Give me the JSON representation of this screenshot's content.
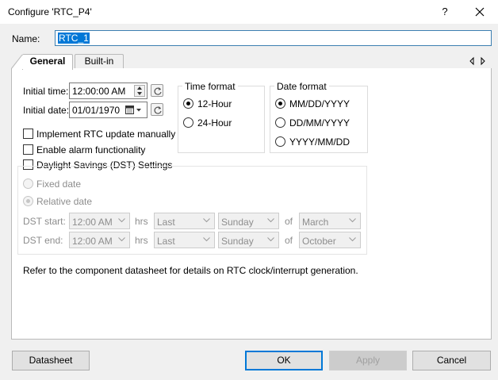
{
  "window": {
    "title": "Configure 'RTC_P4'",
    "help_label": "?"
  },
  "name_field": {
    "label": "Name:",
    "value": "RTC_1"
  },
  "tabs": [
    {
      "label": "General",
      "selected": true
    },
    {
      "label": "Built-in",
      "selected": false
    }
  ],
  "general": {
    "initial_time_label": "Initial time:",
    "initial_time_value": "12:00:00 AM",
    "initial_date_label": "Initial date:",
    "initial_date_value": "01/01/1970",
    "time_format": {
      "title": "Time format",
      "options": [
        "12-Hour",
        "24-Hour"
      ],
      "selected": "12-Hour"
    },
    "date_format": {
      "title": "Date format",
      "options": [
        "MM/DD/YYYY",
        "DD/MM/YYYY",
        "YYYY/MM/DD"
      ],
      "selected": "MM/DD/YYYY"
    },
    "checkboxes": {
      "manual_update": "Implement RTC update manually",
      "alarm": "Enable alarm functionality",
      "dst": "Daylight Savings (DST) Settings"
    },
    "dst": {
      "fixed_date": "Fixed date",
      "relative_date": "Relative date",
      "start_label": "DST start:",
      "end_label": "DST end:",
      "hrs_label": "hrs",
      "of_label": "of",
      "start": {
        "time": "12:00 AM",
        "week": "Last",
        "day": "Sunday",
        "month": "March"
      },
      "end": {
        "time": "12:00 AM",
        "week": "Last",
        "day": "Sunday",
        "month": "October"
      }
    },
    "info_text": "Refer to the component datasheet for details on RTC clock/interrupt generation."
  },
  "buttons": {
    "datasheet": "Datasheet",
    "ok": "OK",
    "apply": "Apply",
    "cancel": "Cancel"
  },
  "colors": {
    "selection": "#0078d7",
    "window_bg": "#f0f0f0",
    "panel_bg": "#ffffff",
    "disabled_text": "#8d8d8d"
  }
}
